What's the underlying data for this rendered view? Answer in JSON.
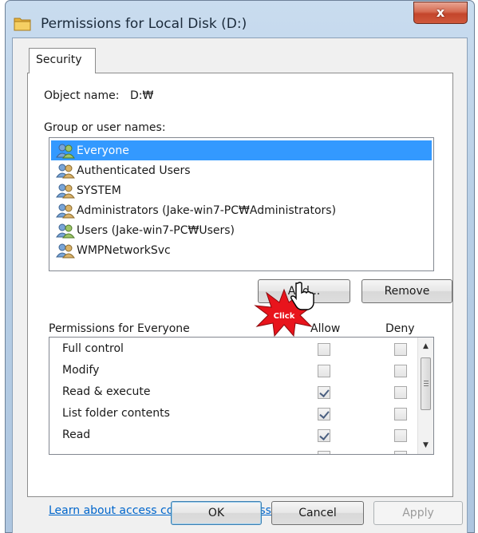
{
  "window": {
    "title": "Permissions for Local Disk (D:)",
    "close_label": "x"
  },
  "tabs": [
    {
      "label": "Security"
    }
  ],
  "object": {
    "label": "Object name:",
    "value": "D:₩"
  },
  "groups": {
    "label": "Group or user names:",
    "items": [
      {
        "label": "Everyone",
        "selected": true
      },
      {
        "label": "Authenticated Users",
        "selected": false
      },
      {
        "label": "SYSTEM",
        "selected": false
      },
      {
        "label": "Administrators (Jake-win7-PC₩Administrators)",
        "selected": false
      },
      {
        "label": "Users (Jake-win7-PC₩Users)",
        "selected": false
      },
      {
        "label": "WMPNetworkSvc",
        "selected": false
      }
    ]
  },
  "buttons": {
    "add": "Add...",
    "remove": "Remove",
    "ok": "OK",
    "cancel": "Cancel",
    "apply": "Apply"
  },
  "permissions": {
    "header": "Permissions for Everyone",
    "allow_header": "Allow",
    "deny_header": "Deny",
    "rows": [
      {
        "name": "Full control",
        "allow": false,
        "deny": false
      },
      {
        "name": "Modify",
        "allow": false,
        "deny": false
      },
      {
        "name": "Read & execute",
        "allow": true,
        "deny": false
      },
      {
        "name": "List folder contents",
        "allow": true,
        "deny": false
      },
      {
        "name": "Read",
        "allow": true,
        "deny": false
      }
    ]
  },
  "link": "Learn about access control and permissions",
  "callout": {
    "text": "Click"
  },
  "colors": {
    "selection": "#3399ff",
    "link": "#0066cc",
    "callout": "#e8141c"
  },
  "icons": [
    "folder-icon",
    "close-icon",
    "user-group-icon",
    "checkbox-icon",
    "hand-cursor-icon",
    "click-burst-icon"
  ]
}
